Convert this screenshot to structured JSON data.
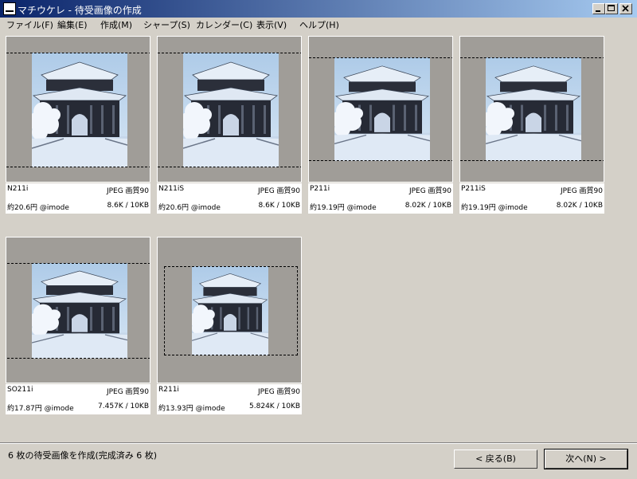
{
  "window": {
    "title": "マチウケレ - 待受画像の作成"
  },
  "menu": [
    "ファイル(F)",
    "編集(E)",
    "作成(M)",
    "シャープ(S)",
    "カレンダー(C)",
    "表示(V)",
    "ヘルプ(H)"
  ],
  "tiles": [
    {
      "model": "N211i",
      "quality": "JPEG 画質90",
      "cost": "約20.6円 @imode",
      "size": "8.6K / 10KB"
    },
    {
      "model": "N211iS",
      "quality": "JPEG 画質90",
      "cost": "約20.6円 @imode",
      "size": "8.6K / 10KB"
    },
    {
      "model": "P211i",
      "quality": "JPEG 画質90",
      "cost": "約19.19円 @imode",
      "size": "8.02K / 10KB"
    },
    {
      "model": "P211iS",
      "quality": "JPEG 画質90",
      "cost": "約19.19円 @imode",
      "size": "8.02K / 10KB"
    },
    {
      "model": "SO211i",
      "quality": "JPEG 画質90",
      "cost": "約17.87円 @imode",
      "size": "7.457K / 10KB"
    },
    {
      "model": "R211i",
      "quality": "JPEG 画質90",
      "cost": "約13.93円 @imode",
      "size": "5.824K / 10KB"
    }
  ],
  "status": {
    "text": "6 枚の待受画像を作成(完成済み 6 枚)"
  },
  "buttons": {
    "back": "< 戻る(B)",
    "next": "次へ(N) >"
  }
}
